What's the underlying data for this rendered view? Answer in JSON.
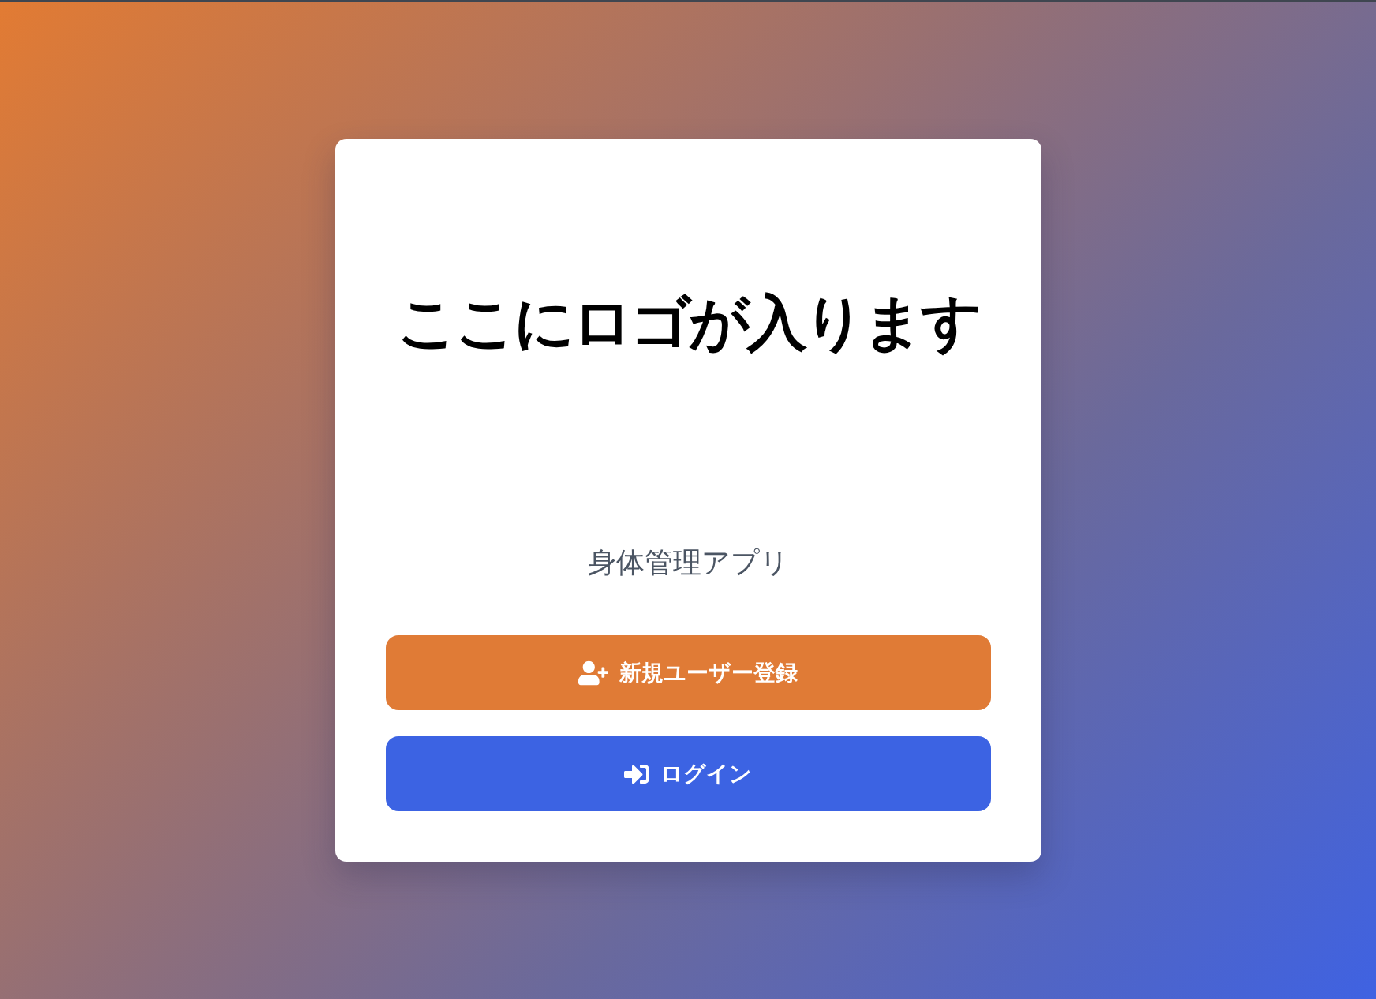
{
  "logo": {
    "text": "ここにロゴが入ります"
  },
  "subtitle": "身体管理アプリ",
  "buttons": [
    {
      "label": "新規ユーザー登録",
      "kind": "register"
    },
    {
      "label": "ログイン",
      "kind": "login"
    }
  ]
}
